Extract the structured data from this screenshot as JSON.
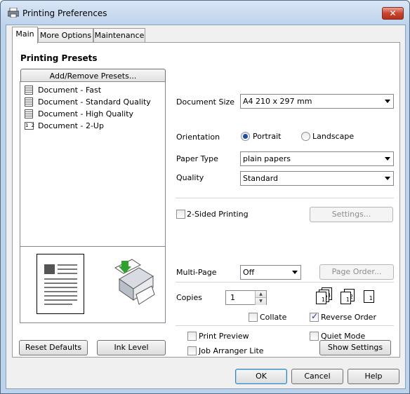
{
  "window": {
    "title": "Printing Preferences",
    "close_glyph": "✕"
  },
  "tabs": [
    {
      "label": "Main",
      "active": true
    },
    {
      "label": "More Options",
      "active": false
    },
    {
      "label": "Maintenance",
      "active": false
    }
  ],
  "presets": {
    "heading": "Printing Presets",
    "add_remove_label": "Add/Remove Presets...",
    "items": [
      {
        "label": "Document - Fast",
        "icon": "document-icon"
      },
      {
        "label": "Document - Standard Quality",
        "icon": "document-icon"
      },
      {
        "label": "Document - High Quality",
        "icon": "document-icon"
      },
      {
        "label": "Document - 2-Up",
        "icon": "two-up-icon",
        "icon_text": "1 2"
      }
    ]
  },
  "settings": {
    "document_size_label": "Document Size",
    "document_size_value": "A4 210 x 297 mm",
    "orientation_label": "Orientation",
    "portrait_label": "Portrait",
    "landscape_label": "Landscape",
    "orientation_selected": "Portrait",
    "paper_type_label": "Paper Type",
    "paper_type_value": "plain papers",
    "quality_label": "Quality",
    "quality_value": "Standard",
    "two_sided_label": "2-Sided Printing",
    "two_sided_checked": false,
    "settings_button_label": "Settings...",
    "multi_page_label": "Multi-Page",
    "multi_page_value": "Off",
    "page_order_label": "Page Order...",
    "copies_label": "Copies",
    "copies_value": "1",
    "collate_label": "Collate",
    "collate_checked": false,
    "reverse_order_label": "Reverse Order",
    "reverse_order_checked": true,
    "print_preview_label": "Print Preview",
    "print_preview_checked": false,
    "quiet_mode_label": "Quiet Mode",
    "quiet_mode_checked": false,
    "job_arranger_label": "Job Arranger Lite",
    "job_arranger_checked": false,
    "show_settings_label": "Show Settings"
  },
  "collate_pages": [
    {
      "pages": [
        "3",
        "2",
        "1"
      ]
    },
    {
      "pages": [
        "2",
        "1"
      ]
    },
    {
      "pages": [
        "1"
      ]
    }
  ],
  "bottom_left": {
    "reset_defaults_label": "Reset Defaults",
    "ink_level_label": "Ink Level"
  },
  "footer": {
    "ok_label": "OK",
    "cancel_label": "Cancel",
    "help_label": "Help"
  },
  "colors": {
    "accent_blue": "#1e4f9c",
    "close_red": "#c8452f",
    "printer_green": "#2fa12f"
  }
}
